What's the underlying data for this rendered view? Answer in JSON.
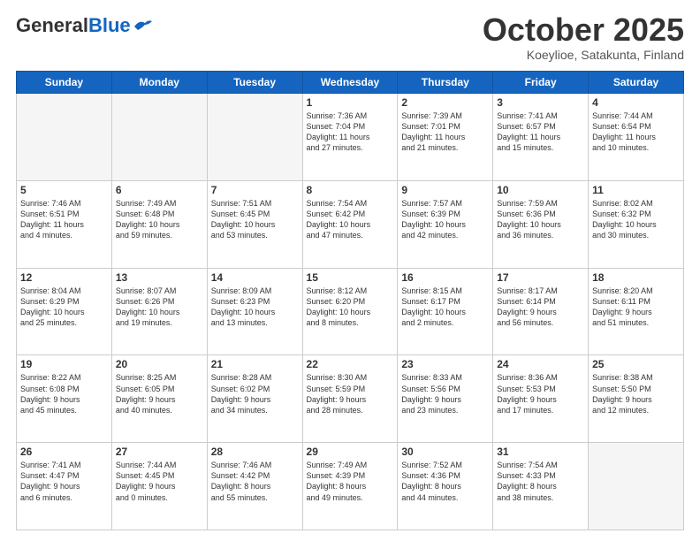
{
  "header": {
    "logo_general": "General",
    "logo_blue": "Blue",
    "month_title": "October 2025",
    "location": "Koeylioe, Satakunta, Finland"
  },
  "weekdays": [
    "Sunday",
    "Monday",
    "Tuesday",
    "Wednesday",
    "Thursday",
    "Friday",
    "Saturday"
  ],
  "weeks": [
    [
      {
        "day": "",
        "lines": []
      },
      {
        "day": "",
        "lines": []
      },
      {
        "day": "",
        "lines": []
      },
      {
        "day": "1",
        "lines": [
          "Sunrise: 7:36 AM",
          "Sunset: 7:04 PM",
          "Daylight: 11 hours",
          "and 27 minutes."
        ]
      },
      {
        "day": "2",
        "lines": [
          "Sunrise: 7:39 AM",
          "Sunset: 7:01 PM",
          "Daylight: 11 hours",
          "and 21 minutes."
        ]
      },
      {
        "day": "3",
        "lines": [
          "Sunrise: 7:41 AM",
          "Sunset: 6:57 PM",
          "Daylight: 11 hours",
          "and 15 minutes."
        ]
      },
      {
        "day": "4",
        "lines": [
          "Sunrise: 7:44 AM",
          "Sunset: 6:54 PM",
          "Daylight: 11 hours",
          "and 10 minutes."
        ]
      }
    ],
    [
      {
        "day": "5",
        "lines": [
          "Sunrise: 7:46 AM",
          "Sunset: 6:51 PM",
          "Daylight: 11 hours",
          "and 4 minutes."
        ]
      },
      {
        "day": "6",
        "lines": [
          "Sunrise: 7:49 AM",
          "Sunset: 6:48 PM",
          "Daylight: 10 hours",
          "and 59 minutes."
        ]
      },
      {
        "day": "7",
        "lines": [
          "Sunrise: 7:51 AM",
          "Sunset: 6:45 PM",
          "Daylight: 10 hours",
          "and 53 minutes."
        ]
      },
      {
        "day": "8",
        "lines": [
          "Sunrise: 7:54 AM",
          "Sunset: 6:42 PM",
          "Daylight: 10 hours",
          "and 47 minutes."
        ]
      },
      {
        "day": "9",
        "lines": [
          "Sunrise: 7:57 AM",
          "Sunset: 6:39 PM",
          "Daylight: 10 hours",
          "and 42 minutes."
        ]
      },
      {
        "day": "10",
        "lines": [
          "Sunrise: 7:59 AM",
          "Sunset: 6:36 PM",
          "Daylight: 10 hours",
          "and 36 minutes."
        ]
      },
      {
        "day": "11",
        "lines": [
          "Sunrise: 8:02 AM",
          "Sunset: 6:32 PM",
          "Daylight: 10 hours",
          "and 30 minutes."
        ]
      }
    ],
    [
      {
        "day": "12",
        "lines": [
          "Sunrise: 8:04 AM",
          "Sunset: 6:29 PM",
          "Daylight: 10 hours",
          "and 25 minutes."
        ]
      },
      {
        "day": "13",
        "lines": [
          "Sunrise: 8:07 AM",
          "Sunset: 6:26 PM",
          "Daylight: 10 hours",
          "and 19 minutes."
        ]
      },
      {
        "day": "14",
        "lines": [
          "Sunrise: 8:09 AM",
          "Sunset: 6:23 PM",
          "Daylight: 10 hours",
          "and 13 minutes."
        ]
      },
      {
        "day": "15",
        "lines": [
          "Sunrise: 8:12 AM",
          "Sunset: 6:20 PM",
          "Daylight: 10 hours",
          "and 8 minutes."
        ]
      },
      {
        "day": "16",
        "lines": [
          "Sunrise: 8:15 AM",
          "Sunset: 6:17 PM",
          "Daylight: 10 hours",
          "and 2 minutes."
        ]
      },
      {
        "day": "17",
        "lines": [
          "Sunrise: 8:17 AM",
          "Sunset: 6:14 PM",
          "Daylight: 9 hours",
          "and 56 minutes."
        ]
      },
      {
        "day": "18",
        "lines": [
          "Sunrise: 8:20 AM",
          "Sunset: 6:11 PM",
          "Daylight: 9 hours",
          "and 51 minutes."
        ]
      }
    ],
    [
      {
        "day": "19",
        "lines": [
          "Sunrise: 8:22 AM",
          "Sunset: 6:08 PM",
          "Daylight: 9 hours",
          "and 45 minutes."
        ]
      },
      {
        "day": "20",
        "lines": [
          "Sunrise: 8:25 AM",
          "Sunset: 6:05 PM",
          "Daylight: 9 hours",
          "and 40 minutes."
        ]
      },
      {
        "day": "21",
        "lines": [
          "Sunrise: 8:28 AM",
          "Sunset: 6:02 PM",
          "Daylight: 9 hours",
          "and 34 minutes."
        ]
      },
      {
        "day": "22",
        "lines": [
          "Sunrise: 8:30 AM",
          "Sunset: 5:59 PM",
          "Daylight: 9 hours",
          "and 28 minutes."
        ]
      },
      {
        "day": "23",
        "lines": [
          "Sunrise: 8:33 AM",
          "Sunset: 5:56 PM",
          "Daylight: 9 hours",
          "and 23 minutes."
        ]
      },
      {
        "day": "24",
        "lines": [
          "Sunrise: 8:36 AM",
          "Sunset: 5:53 PM",
          "Daylight: 9 hours",
          "and 17 minutes."
        ]
      },
      {
        "day": "25",
        "lines": [
          "Sunrise: 8:38 AM",
          "Sunset: 5:50 PM",
          "Daylight: 9 hours",
          "and 12 minutes."
        ]
      }
    ],
    [
      {
        "day": "26",
        "lines": [
          "Sunrise: 7:41 AM",
          "Sunset: 4:47 PM",
          "Daylight: 9 hours",
          "and 6 minutes."
        ]
      },
      {
        "day": "27",
        "lines": [
          "Sunrise: 7:44 AM",
          "Sunset: 4:45 PM",
          "Daylight: 9 hours",
          "and 0 minutes."
        ]
      },
      {
        "day": "28",
        "lines": [
          "Sunrise: 7:46 AM",
          "Sunset: 4:42 PM",
          "Daylight: 8 hours",
          "and 55 minutes."
        ]
      },
      {
        "day": "29",
        "lines": [
          "Sunrise: 7:49 AM",
          "Sunset: 4:39 PM",
          "Daylight: 8 hours",
          "and 49 minutes."
        ]
      },
      {
        "day": "30",
        "lines": [
          "Sunrise: 7:52 AM",
          "Sunset: 4:36 PM",
          "Daylight: 8 hours",
          "and 44 minutes."
        ]
      },
      {
        "day": "31",
        "lines": [
          "Sunrise: 7:54 AM",
          "Sunset: 4:33 PM",
          "Daylight: 8 hours",
          "and 38 minutes."
        ]
      },
      {
        "day": "",
        "lines": []
      }
    ]
  ]
}
